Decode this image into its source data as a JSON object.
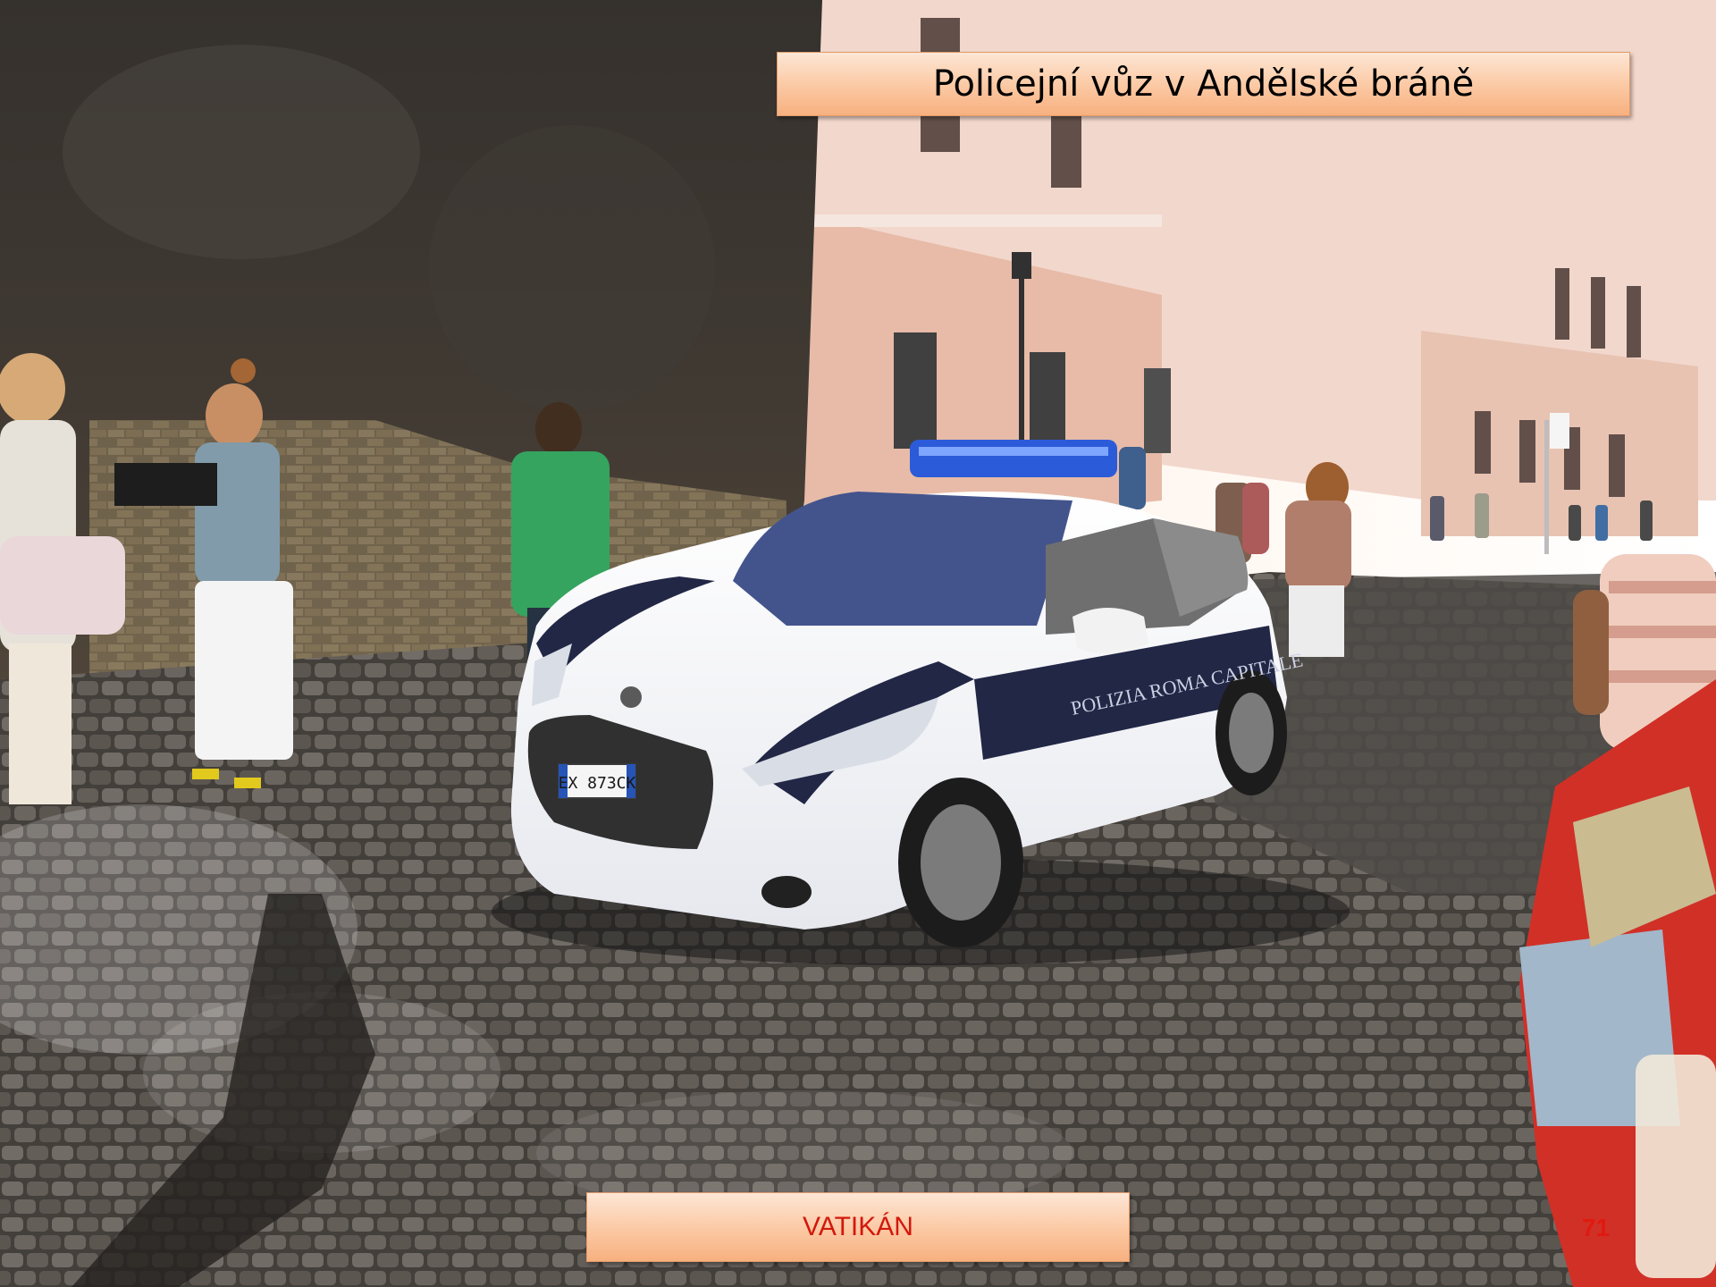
{
  "slide": {
    "title": "Policejní vůz v Andělské bráně",
    "footer": "VATIKÁN",
    "page_number": "71"
  },
  "photo": {
    "car_plate": "EX 873CK",
    "car_livery_text": "POLIZIA ROMA CAPITALE",
    "description_icon": "photo-icon"
  },
  "colors": {
    "caption_fill": "#fbc8a2",
    "footer_text": "#d3180c",
    "page_number": "#e01a10"
  }
}
